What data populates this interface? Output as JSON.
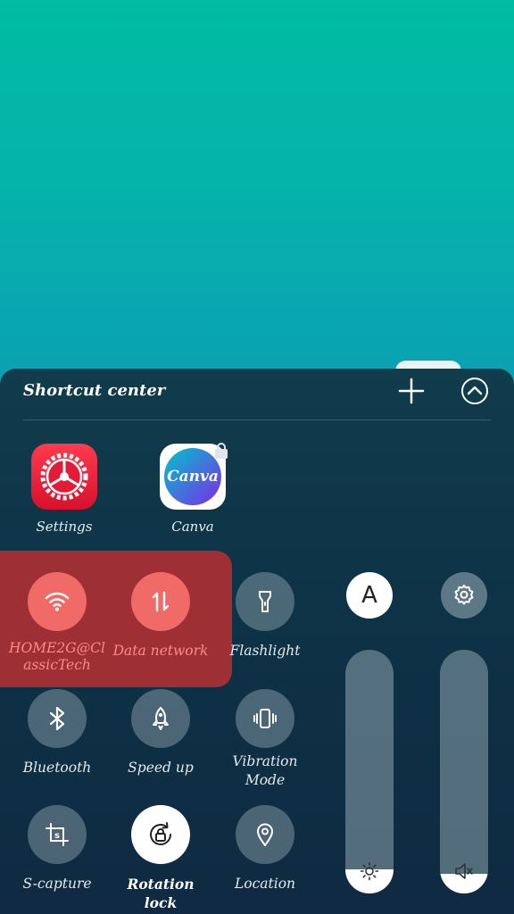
{
  "panel": {
    "title": "Shortcut center",
    "add_icon": "plus-icon",
    "collapse_icon": "chevron-up-circle-icon"
  },
  "apps": [
    {
      "label": "Settings",
      "icon": "settings-app-icon",
      "color": "#e0203a"
    },
    {
      "label": "Canva",
      "icon": "canva-app-icon",
      "icon_text": "Canva",
      "color": "#7d2ae8"
    }
  ],
  "toggles": [
    {
      "label": "HOME2G@Cl\nassicTech",
      "icon": "wifi-icon",
      "active": true
    },
    {
      "label": "Data network",
      "icon": "data-network-icon",
      "active": true
    },
    {
      "label": "Flashlight",
      "icon": "flashlight-icon",
      "active": false
    },
    {
      "label": "Bluetooth",
      "icon": "bluetooth-icon",
      "active": false
    },
    {
      "label": "Speed up",
      "icon": "rocket-icon",
      "active": false
    },
    {
      "label": "Vibration Mode",
      "icon": "vibration-icon",
      "active": false
    },
    {
      "label": "S-capture",
      "icon": "s-capture-icon",
      "active": false
    },
    {
      "label": "Rotation lock",
      "icon": "rotation-lock-icon",
      "active": true
    },
    {
      "label": "Location",
      "icon": "location-icon",
      "active": false
    }
  ],
  "controls": {
    "auto_brightness_label": "A",
    "brightness_level": 0.1,
    "volume_level": 0.08,
    "brightness_icon": "sun-icon",
    "volume_icon": "speaker-icon",
    "settings_icon": "gear-icon"
  },
  "colors": {
    "active_toggle": "#f06a68",
    "highlight": "#9d2f35",
    "panel": "#0e3246"
  }
}
